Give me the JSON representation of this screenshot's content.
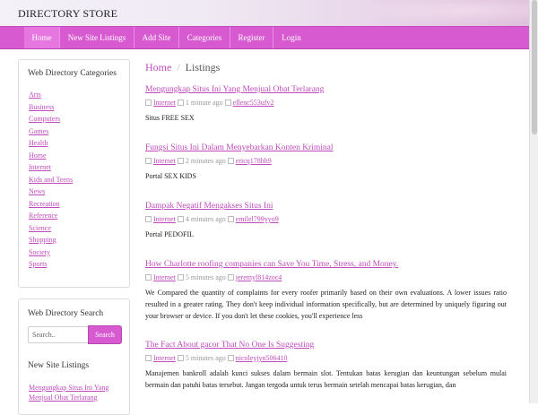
{
  "brand": "DIRECTORY STORE",
  "nav": [
    "Home",
    "New Site Listings",
    "Add Site",
    "Categories",
    "Register",
    "Login"
  ],
  "sidebar": {
    "categories_title": "Web Directory Categories",
    "categories": [
      "Arts",
      "Business",
      "Computers",
      "Games",
      "Health",
      "Home",
      "Internet",
      "Kids and Teens",
      "News",
      "Recreation",
      "Reference",
      "Science",
      "Shopping",
      "Society",
      "Sports"
    ],
    "search_title": "Web Directory Search",
    "search_placeholder": "Search..",
    "search_button": "Search",
    "new_listings_title": "New Site Listings",
    "new_listings": [
      "Mengungkap Situs Ini Yang Menjual Obat Terlarang"
    ]
  },
  "breadcrumb": {
    "home": "Home",
    "separator": "/",
    "current": "Listings"
  },
  "listings": [
    {
      "title": "Mengungkap Situs Ini Yang Menjual Obat Terlarang",
      "category": "Internet",
      "time": "1 minute ago",
      "user": "ellenc553ufv2",
      "description": "Situs FREE SEX"
    },
    {
      "title": "Fungsi Situs Ini Dalam Menyebarkan Konten Kriminal",
      "category": "Internet",
      "time": "2 minutes ago",
      "user": "ericq178hh9",
      "description": "Portal SEX KIDS"
    },
    {
      "title": "Dampak Negatif Mengakses Situs Ini",
      "category": "Internet",
      "time": "4 minutes ago",
      "user": "emilel799yyo9",
      "description": "Portal PEDOFIL"
    },
    {
      "title": "How Charlotte roofing companies can Save You Time, Stress, and Money.",
      "category": "Internet",
      "time": "5 minutes ago",
      "user": "jeremyl814zoc4",
      "description": "We Compared the quantity of complaints for every roofer primarily based on their own evaluations. A lower issues ratio resulted in a greater rating. They don't keep individual information specifically, but are determined by uniquely figuring out your browser or device. If you don't let these cookies, you'll experience less"
    },
    {
      "title": "The Fact About gacor That No One Is Suggesting",
      "category": "Internet",
      "time": "5 minutes ago",
      "user": "nicoleyjyn506410",
      "description": "Manajemen bankroll adalah kunci sukses dalam bermain slot. Tentukan batas kerugian dan keuntungan sebelum mulai bermain dan patuhi batas tersebut. Jangan tergoda untuk terus bermain setelah mencapai batas kerugian, dan"
    }
  ],
  "colors": {
    "accent": "#d85ad0",
    "link": "#c04bbc"
  }
}
